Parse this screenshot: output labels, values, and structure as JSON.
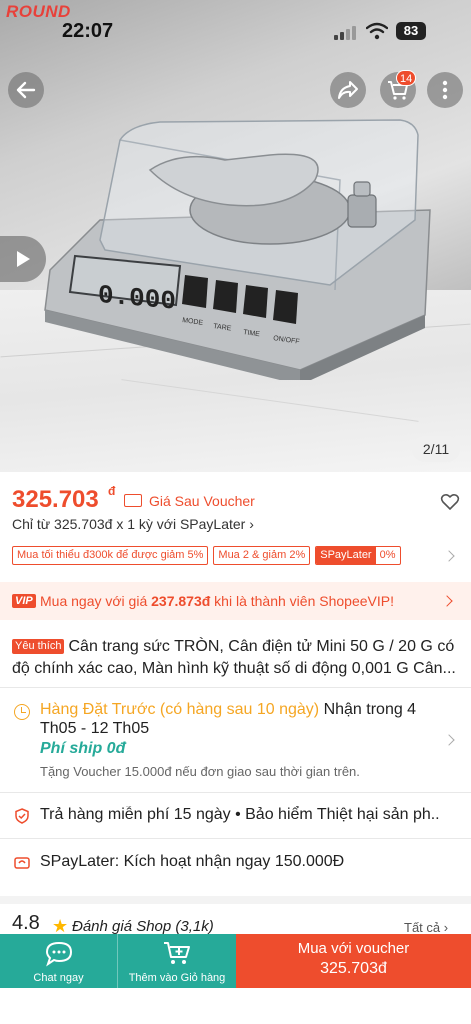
{
  "status_bar": {
    "brand_tag": "ROUND",
    "time": "22:07",
    "battery": "83"
  },
  "hero": {
    "image_counter": "2/11",
    "cart_count": "14",
    "scale_buttons": [
      "MODE",
      "TARE",
      "TIME",
      "ON/OFF"
    ],
    "display_value": "0.000"
  },
  "price": {
    "amount": "325.703",
    "currency": "đ",
    "voucher_label": "Giá Sau Voucher",
    "spaylater_line": "Chỉ từ 325.703đ x 1 kỳ với SPayLater ›"
  },
  "promo_tags": [
    "Mua tối thiểu đ300k để được giảm 5%",
    "Mua 2 & giảm 2%"
  ],
  "spay_tag": {
    "name": "SPayLater",
    "rate": "0%"
  },
  "vip": {
    "badge": "VIP",
    "prefix": "Mua ngay với giá ",
    "price": "237.873đ",
    "suffix": " khi là thành viên ShopeeVIP!"
  },
  "product": {
    "fav_tag": "Yêu thích",
    "title": "Cân trang sức TRÒN, Cân điện tử Mini 50 G / 20 G có độ chính xác cao, Màn hình kỹ thuật số di động 0,001 G Cân..."
  },
  "shipping": {
    "highlight": "Hàng Đặt Trước (có hàng sau 10 ngày)",
    "rest": " Nhận trong 4 Th05 - 12 Th05",
    "fee": "Phí ship 0đ",
    "note": "Tặng Voucher 15.000đ nếu đơn giao sau thời gian trên."
  },
  "guarantee": "Trả hàng miễn phí 15 ngày  •  Bảo hiểm Thiệt hại sản ph...",
  "spaylater_activation": "SPayLater: Kích hoạt nhận ngay 150.000Đ",
  "rating": {
    "score": "4.8",
    "label": "Đánh giá Shop",
    "count": "(3,1k)",
    "all_link": "Tất cả ›"
  },
  "bottom_bar": {
    "chat_label": "Chat ngay",
    "cart_label": "Thêm vào Giỏ hàng",
    "buy_line1": "Mua với voucher",
    "buy_line2": "325.703đ"
  },
  "colors": {
    "accent": "#ee4d2d",
    "teal": "#26aa99",
    "shipping_orange": "#f5a623"
  }
}
